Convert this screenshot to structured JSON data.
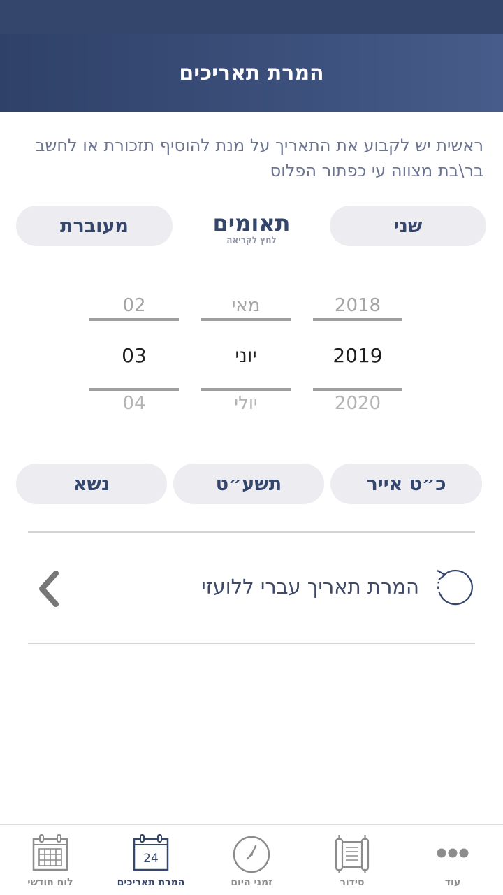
{
  "header": {
    "title": "המרת תאריכים"
  },
  "intro": {
    "text": "ראשית יש לקבוע את התאריך על מנת להוסיף תזכורת או לחשב בר\\בת מצווה עי כפתור הפלוס"
  },
  "info": {
    "weekday": "שני",
    "zodiac": "תאומים",
    "zodiac_hint": "לחץ לקריאה",
    "leap_status": "מעוברת"
  },
  "picker": {
    "year": {
      "prev": "2018",
      "current": "2019",
      "next": "2020"
    },
    "month": {
      "prev": "מאי",
      "current": "יוני",
      "next": "יולי"
    },
    "day": {
      "prev": "02",
      "current": "03",
      "next": "04"
    }
  },
  "hebrew": {
    "date": "כ״ט אייר",
    "year": "תשע״ט",
    "parasha": "נשא"
  },
  "convert": {
    "label": "המרת תאריך עברי ללועזי"
  },
  "tabs": [
    {
      "label": "לוח חודשי",
      "icon": "calendar-grid-icon"
    },
    {
      "label": "המרת תאריכים",
      "icon": "calendar-24-icon",
      "badge": "24",
      "active": true
    },
    {
      "label": "זמני היום",
      "icon": "clock-icon"
    },
    {
      "label": "סידור",
      "icon": "scroll-icon"
    },
    {
      "label": "עוד",
      "icon": "more-dots-icon"
    }
  ],
  "colors": {
    "primary": "#34466b",
    "pill_bg": "#ececf1",
    "inactive": "#8c8c8c"
  }
}
